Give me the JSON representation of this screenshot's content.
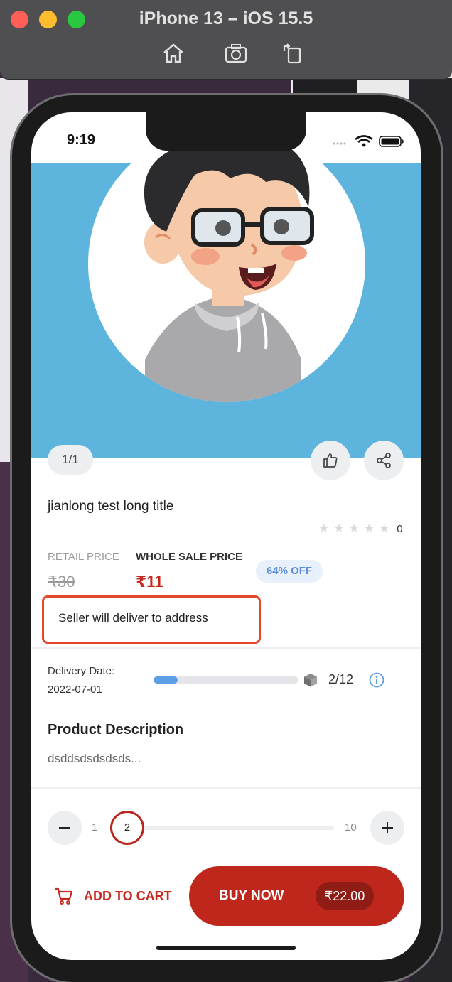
{
  "simulator": {
    "title": "iPhone 13 – iOS 15.5",
    "tools": [
      "home-icon",
      "screenshot-icon",
      "rotate-icon"
    ]
  },
  "status_bar": {
    "time": "9:19"
  },
  "product": {
    "image_counter": "1/1",
    "title": "jianlong test long title",
    "rating_count": "0",
    "retail_price_label": "RETAIL PRICE",
    "retail_price": "₹30",
    "wholesale_price_label": "WHOLE SALE PRICE",
    "wholesale_price": "₹11",
    "discount_badge": "64% OFF",
    "delivery_note": "Seller will deliver to address"
  },
  "delivery": {
    "label": "Delivery Date:",
    "date": "2022-07-01",
    "stock_text": "2/12",
    "stock_progress": 0.1667
  },
  "description": {
    "heading": "Product Description",
    "text": "dsddsdsdsdsds..."
  },
  "quantity": {
    "min": "1",
    "max": "10",
    "current": "2"
  },
  "actions": {
    "add_to_cart": "ADD TO CART",
    "buy_now": "BUY NOW",
    "total": "₹22.00"
  },
  "colors": {
    "accent": "#bf271c",
    "hero_bg": "#5db4dc",
    "highlight_border": "#e5472d",
    "progress": "#5a9fe8"
  }
}
